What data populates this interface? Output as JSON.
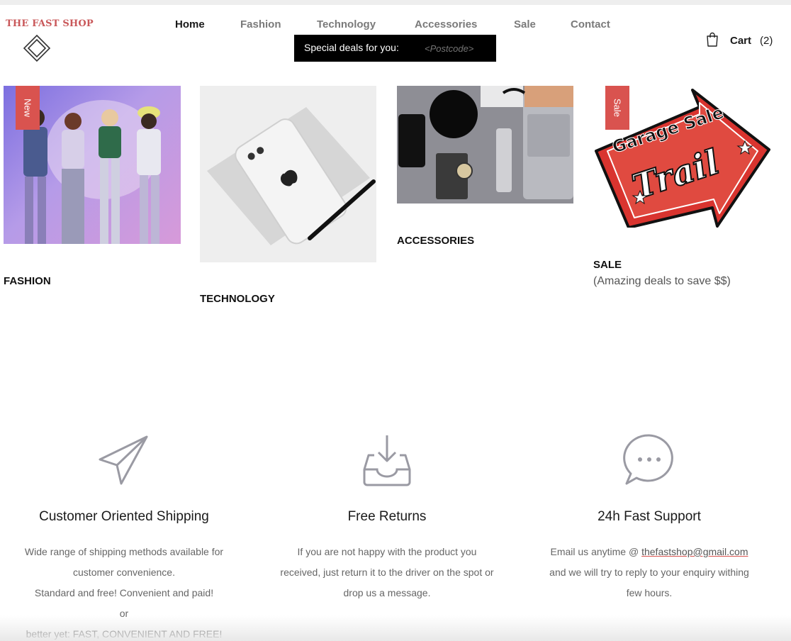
{
  "logo": {
    "text": "THE FAST SHOP"
  },
  "nav": {
    "items": [
      {
        "label": "Home",
        "active": true
      },
      {
        "label": "Fashion",
        "active": false
      },
      {
        "label": "Technology",
        "active": false
      },
      {
        "label": "Accessories",
        "active": false
      },
      {
        "label": "Sale",
        "active": false
      },
      {
        "label": "Contact",
        "active": false
      }
    ]
  },
  "deals": {
    "label": "Special deals for you:",
    "placeholder": "<Postcode>"
  },
  "cart": {
    "label": "Cart",
    "count": "(2)"
  },
  "categories": [
    {
      "title": "FASHION",
      "badge": "New"
    },
    {
      "title": "TECHNOLOGY"
    },
    {
      "title": "ACCESSORIES"
    },
    {
      "title": "SALE",
      "subtitle": "(Amazing deals to save $$)",
      "badge": "Sale",
      "image_text_1": "Garage Sale",
      "image_text_2": "Trail"
    }
  ],
  "features": [
    {
      "icon": "paper-plane-icon",
      "title": "Customer Oriented Shipping",
      "lines": [
        "Wide range of shipping methods available for",
        "customer convenience.",
        "Standard and free! Convenient and paid!",
        "or",
        "better yet: FAST, CONVENIENT AND FREE!"
      ]
    },
    {
      "icon": "inbox-download-icon",
      "title": "Free Returns",
      "lines": [
        "If you are not happy with the product you",
        "received, just return it to the driver on the spot or",
        "drop us a message."
      ]
    },
    {
      "icon": "chat-bubble-icon",
      "title": "24h Fast Support",
      "email_prefix": "Email us anytime @ ",
      "email": "thefastshop@gmail.com",
      "lines": [
        "and we will try to reply to your enquiry withing",
        "few hours."
      ]
    }
  ],
  "colors": {
    "accent": "#d9534f",
    "icon": "#9a9aa3"
  }
}
